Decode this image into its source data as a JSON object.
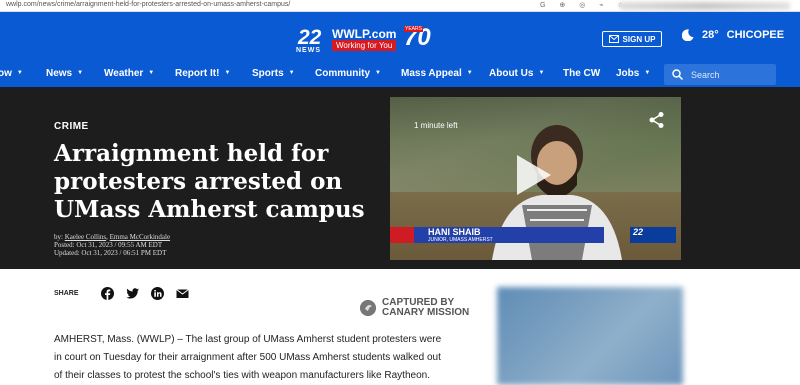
{
  "browser": {
    "url": "wwlp.com/news/crime/arraignment-held-for-protesters-arrested-on-umass-amherst-campus/"
  },
  "header": {
    "logo": {
      "number": "22",
      "news": "NEWS",
      "site": "WWLP.com",
      "tagline": "Working for You",
      "anniversary": "70",
      "years": "YEARS"
    },
    "signup_label": "SIGN UP",
    "weather": {
      "temp": "28°",
      "city": "CHICOPEE"
    }
  },
  "nav": {
    "items": [
      "ow",
      "News",
      "Weather",
      "Report It!",
      "Sports",
      "Community",
      "Mass Appeal",
      "About Us",
      "The CW",
      "Jobs"
    ],
    "search_placeholder": "Search"
  },
  "hero": {
    "section": "CRIME",
    "headline": "Arraignment held for protesters arrested on UMass Amherst campus",
    "byline_prefix": "by: ",
    "author1": "Kaelee Collins",
    "author2": "Emma McCorkindale",
    "posted": "Posted: Oct 31, 2023 / 09:55 AM EDT",
    "updated": "Updated: Oct 31, 2023 / 06:51 PM EDT",
    "video": {
      "time_left": "1 minute left",
      "lower_third_name": "HANI SHAIB",
      "lower_third_title": "JUNIOR, UMASS AMHERST",
      "logo": "22"
    }
  },
  "article": {
    "share_label": "SHARE",
    "captured_line1": "CAPTURED BY",
    "captured_line2": "CANARY MISSION",
    "paragraph": "AMHERST, Mass. (WWLP) – The last group of UMass Amherst student protesters were in court on Tuesday for their arraignment after 500 UMass Amherst students walked out of their classes to protest the school's ties with weapon manufacturers like Raytheon."
  }
}
